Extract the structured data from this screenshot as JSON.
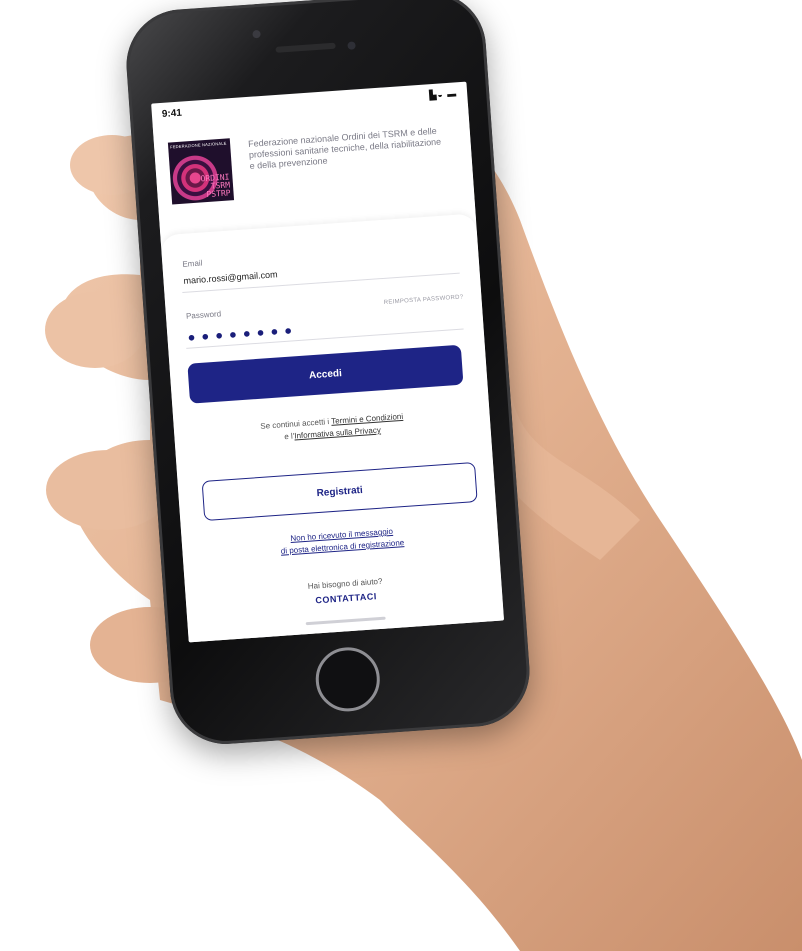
{
  "status_bar": {
    "time": "9:41",
    "icons": "▙◒ ▬"
  },
  "header": {
    "logo_top": "FEDERAZIONE NAZIONALE",
    "logo_text": "ORDINI\nTSRM\nPSTRP",
    "org_description": "Federazione nazionale Ordini dei TSRM e delle professioni sanitarie tecniche, della riabilitazione e della prevenzione"
  },
  "form": {
    "email_label": "Email",
    "email_value": "mario.rossi@gmail.com",
    "password_label": "Password",
    "password_dots": "●●●●●●●●",
    "forgot_password": "REIMPOSTA PASSWORD?",
    "login_button": "Accedi",
    "terms_prefix": "Se continui accetti i ",
    "terms_link": "Termini e Condizioni",
    "terms_middle": "e l'",
    "privacy_link": "Informativa sulla Privacy",
    "register_button": "Registrati",
    "resend_line1": "Non ho ricevuto il messaggio",
    "resend_line2": "di posta elettronica di registrazione",
    "help_text": "Hai bisogno di aiuto?",
    "contact_link": "CONTATTACI"
  },
  "colors": {
    "primary": "#1e2486",
    "logo_magenta": "#e8468e",
    "skin": "#e7b99a"
  }
}
